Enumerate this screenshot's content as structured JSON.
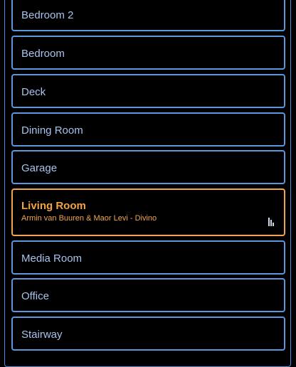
{
  "rooms": [
    {
      "label": "Bedroom 2"
    },
    {
      "label": "Bedroom"
    },
    {
      "label": "Deck"
    },
    {
      "label": "Dining Room"
    },
    {
      "label": "Garage"
    },
    {
      "label": "Living Room",
      "now_playing": "Armin van Buuren & Maor Levi - Divino",
      "active": true
    },
    {
      "label": "Media Room"
    },
    {
      "label": "Office"
    },
    {
      "label": "Stairway"
    }
  ],
  "colors": {
    "accent_blue": "#5f95dc",
    "text_blue": "#a9c3ee",
    "active_orange": "#f2a54a",
    "background": "#000000"
  },
  "icons": {
    "playing_indicator": "equalizer-icon"
  }
}
